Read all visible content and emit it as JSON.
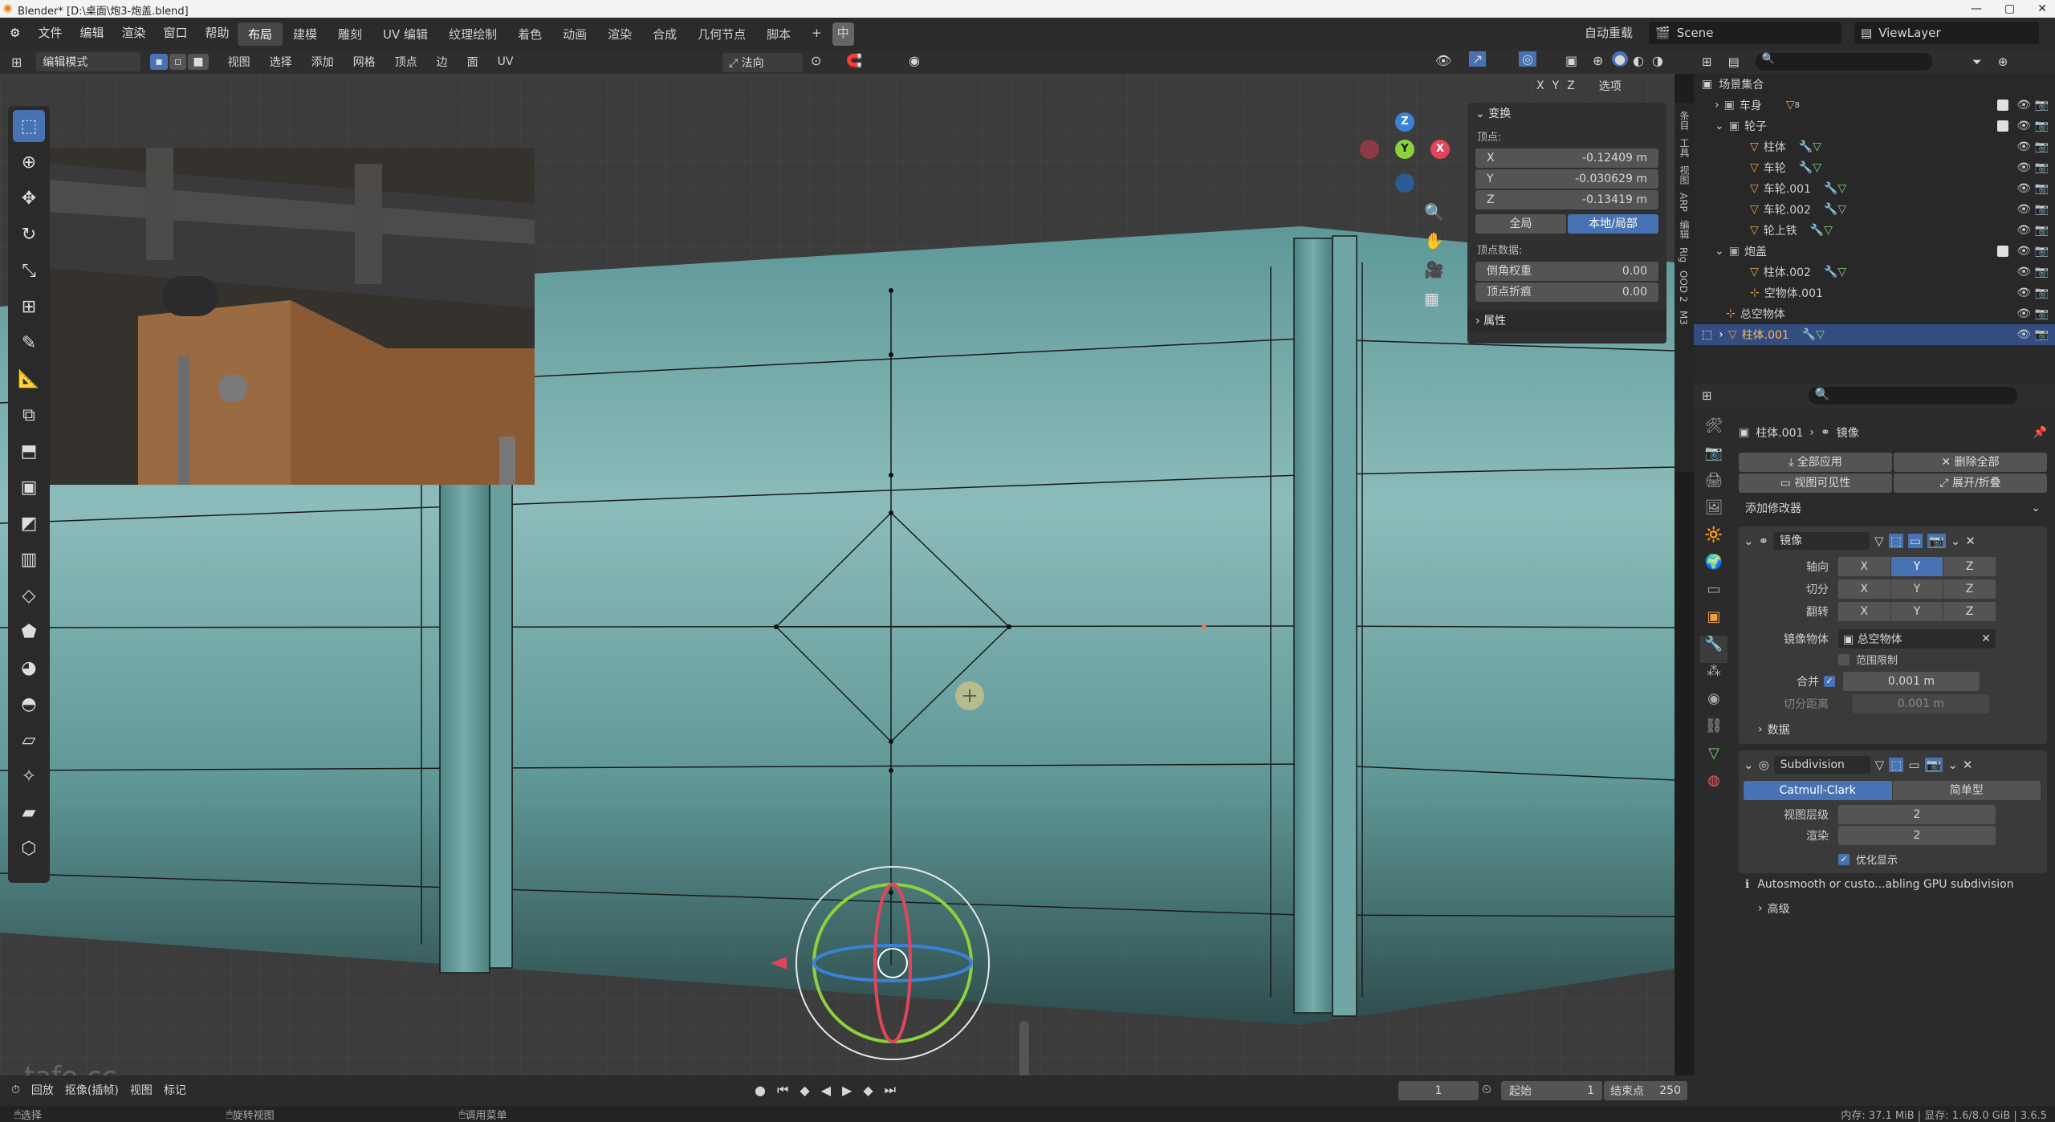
{
  "titlebar": {
    "title": "Blender* [D:\\桌面\\炮3-炮盖.blend]",
    "controls": [
      "—",
      "▢",
      "✕"
    ]
  },
  "menus": [
    "文件",
    "编辑",
    "渲染",
    "窗口",
    "帮助"
  ],
  "workspaces": [
    "布局",
    "建模",
    "雕刻",
    "UV 编辑",
    "纹理绘制",
    "着色",
    "动画",
    "渲染",
    "合成",
    "几何节点",
    "脚本"
  ],
  "active_workspace": "布局",
  "top_right": {
    "auto_reload": "自动重载",
    "scene": "Scene",
    "view_layer": "ViewLayer"
  },
  "vp_header": {
    "mode": "编辑模式",
    "menus": [
      "视图",
      "选择",
      "添加",
      "网格",
      "顶点",
      "边",
      "面",
      "UV"
    ],
    "transform_orientation": "法向",
    "axes": [
      "X",
      "Y",
      "Z"
    ],
    "options": "选项"
  },
  "gizmo": {
    "x": "X",
    "y": "Y",
    "z": "Z"
  },
  "npanel": {
    "transform_title": "变换",
    "vertex_label": "顶点:",
    "fields": [
      {
        "axis": "X",
        "value": "-0.12409 m"
      },
      {
        "axis": "Y",
        "value": "-0.030629 m"
      },
      {
        "axis": "Z",
        "value": "-0.13419 m"
      }
    ],
    "space_global": "全局",
    "space_local": "本地/局部",
    "vertex_data_label": "顶点数据:",
    "bevel_weight_label": "倒角权重",
    "bevel_weight_value": "0.00",
    "crease_label": "顶点折痕",
    "crease_value": "0.00",
    "attributes_title": "属性"
  },
  "side_tabs": [
    "条目",
    "工具",
    "视图",
    "ARP",
    "编辑",
    "Rig",
    "OOD 2",
    "M3"
  ],
  "outliner": {
    "root": "场景集合",
    "rows": [
      {
        "name": "车身",
        "indent": 1,
        "badge": "8"
      },
      {
        "name": "轮子",
        "indent": 1
      },
      {
        "name": "柱体",
        "indent": 2
      },
      {
        "name": "车轮",
        "indent": 2
      },
      {
        "name": "车轮.001",
        "indent": 2
      },
      {
        "name": "车轮.002",
        "indent": 2
      },
      {
        "name": "轮上铁",
        "indent": 2
      },
      {
        "name": "炮盖",
        "indent": 1
      },
      {
        "name": "柱体.002",
        "indent": 2
      },
      {
        "name": "空物体.001",
        "indent": 2
      },
      {
        "name": "总空物体",
        "indent": 1
      },
      {
        "name": "柱体.001",
        "indent": 1,
        "selected": true
      }
    ]
  },
  "properties": {
    "object_name": "柱体.001",
    "context": "镜像",
    "apply_all": "全部应用",
    "delete_all": "删除全部",
    "viewport_vis": "视图可见性",
    "expand_collapse": "展开/折叠",
    "add_modifier": "添加修改器",
    "mirror": {
      "name": "镜像",
      "axis_label": "轴向",
      "bisect_label": "切分",
      "flip_label": "翻转",
      "xyz": [
        "X",
        "Y",
        "Z"
      ],
      "mirror_object_label": "镜像物体",
      "mirror_object": "总空物体",
      "clipping": "范围限制",
      "merge_label": "合并",
      "merge_value": "0.001 m",
      "bisect_distance_label": "切分距离",
      "bisect_distance_value": "0.001 m",
      "data": "数据"
    },
    "subdivision": {
      "name": "Subdivision",
      "catmull": "Catmull-Clark",
      "simple": "简单型",
      "viewport_levels_label": "视图层级",
      "viewport_levels": "2",
      "render_label": "渲染",
      "render_levels": "2",
      "optimal_display": "优化显示",
      "info": "Autosmooth or custo...abling GPU subdivision",
      "advanced": "高级"
    }
  },
  "timeline": {
    "menus": [
      "回放",
      "抠像(插帧)",
      "视图",
      "标记"
    ],
    "current_frame": "1",
    "start_label": "起始",
    "start": "1",
    "end_label": "结束点",
    "end": "250"
  },
  "statusbar": {
    "left": "选择",
    "rotate": "旋转视图",
    "context_menu": "调用菜单",
    "memory": "内存: 37.1 MiB | 显存: 1.6/8.0 GiB | 3.6.5"
  },
  "watermark": "tafe.cc",
  "colors": {
    "accent": "#4772b3",
    "mesh": "#6fa5a4",
    "outliner_selected": "#334d80"
  }
}
